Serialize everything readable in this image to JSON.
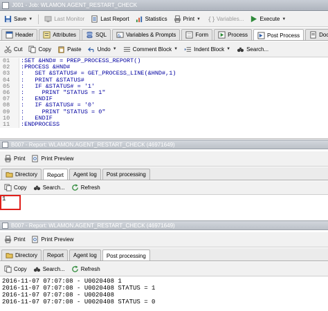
{
  "window": {
    "title": "J001 - Job: WLAMON.AGENT_RESTART_CHECK"
  },
  "toolbar": {
    "save": "Save",
    "last_monitor": "Last Monitor",
    "last_report": "Last Report",
    "statistics": "Statistics",
    "print": "Print",
    "variables": "Variables...",
    "execute": "Execute"
  },
  "object_tabs": [
    {
      "label": "Header"
    },
    {
      "label": "Attributes"
    },
    {
      "label": "SQL"
    },
    {
      "label": "Variables & Prompts"
    },
    {
      "label": "Form"
    },
    {
      "label": "Process"
    },
    {
      "label": "Post Process"
    },
    {
      "label": "Documentatio"
    }
  ],
  "edit_toolbar": {
    "cut": "Cut",
    "copy": "Copy",
    "paste": "Paste",
    "undo": "Undo",
    "comment_block": "Comment Block",
    "indent_block": "Indent Block",
    "search": "Search..."
  },
  "code": {
    "lines": [
      {
        "n": "01",
        "t": ":SET &HND# = PREP_PROCESS_REPORT()"
      },
      {
        "n": "02",
        "t": ":PROCESS &HND#"
      },
      {
        "n": "03",
        "t": ":   SET &STATUS# = GET_PROCESS_LINE(&HND#,1)"
      },
      {
        "n": "04",
        "t": ":   PRINT &STATUS#"
      },
      {
        "n": "05",
        "t": ":   IF &STATUS# = '1'"
      },
      {
        "n": "06",
        "t": ":     PRINT \"STATUS = 1\""
      },
      {
        "n": "07",
        "t": ":   ENDIF"
      },
      {
        "n": "08",
        "t": ":   IF &STATUS# = '0'"
      },
      {
        "n": "09",
        "t": ":     PRINT \"STATUS = 0\""
      },
      {
        "n": "10",
        "t": ":   ENDIF"
      },
      {
        "n": "11",
        "t": ":ENDPROCESS"
      }
    ]
  },
  "report1": {
    "title": "B007 - Report: WLAMON.AGENT_RESTART_CHECK (46971649)",
    "print": "Print",
    "print_preview": "Print Preview",
    "tabs": [
      {
        "label": "Directory"
      },
      {
        "label": "Report"
      },
      {
        "label": "Agent log"
      },
      {
        "label": "Post processing"
      }
    ],
    "copy": "Copy",
    "search": "Search...",
    "refresh": "Refresh",
    "output": [
      "1"
    ]
  },
  "report2": {
    "title": "B007 - Report: WLAMON.AGENT_RESTART_CHECK (46971649)",
    "print": "Print",
    "print_preview": "Print Preview",
    "tabs": [
      {
        "label": "Directory"
      },
      {
        "label": "Report"
      },
      {
        "label": "Agent log"
      },
      {
        "label": "Post processing"
      }
    ],
    "copy": "Copy",
    "search": "Search...",
    "refresh": "Refresh",
    "output": [
      "2016-11-07 07:07:08 - U0020408 1",
      "2016-11-07 07:07:08 - U0020408 STATUS = 1",
      "2016-11-07 07:07:08 - U0020408",
      "2016-11-07 07:07:08 - U0020408 STATUS = 0"
    ]
  },
  "colors": {
    "highlight": "#e0201b",
    "code_keyword": "#0000a0",
    "code_string": "#b00060"
  }
}
